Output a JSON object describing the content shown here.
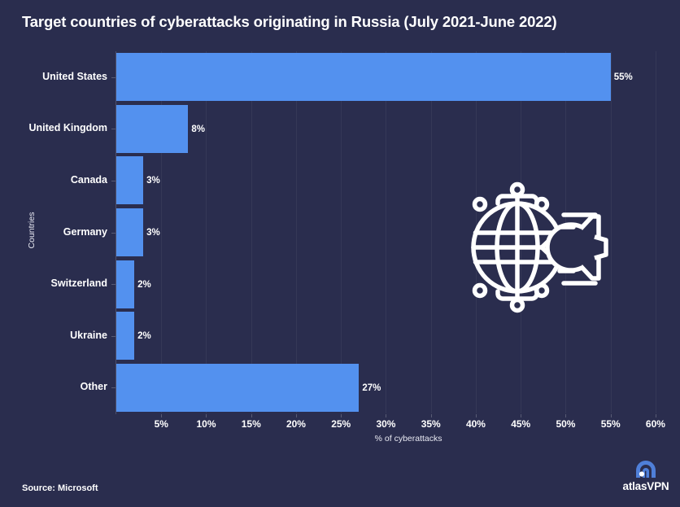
{
  "title": "Target countries of cyberattacks originating in Russia (July 2021-June 2022)",
  "source": "Source: Microsoft",
  "brand": {
    "name": "atlasVPN",
    "mark_icon": "atlasvpn-arc-logo-icon",
    "color": "#4f7fd9"
  },
  "illustration": {
    "icon": "globe-network-missile-icon",
    "color": "#ffffff"
  },
  "colors": {
    "background": "#2a2d4e",
    "bar": "#5391ef",
    "text": "#ffffff",
    "gridline": "rgba(255,255,255,0.055)"
  },
  "chart_data": {
    "type": "bar",
    "orientation": "horizontal",
    "title": "Target countries of cyberattacks originating in Russia (July 2021-June 2022)",
    "xlabel": "% of cyberattacks",
    "ylabel": "Countries",
    "categories": [
      "United States",
      "United Kingdom",
      "Canada",
      "Germany",
      "Switzerland",
      "Ukraine",
      "Other"
    ],
    "values": [
      55,
      8,
      3,
      3,
      2,
      2,
      27
    ],
    "value_labels": [
      "55%",
      "8%",
      "3%",
      "3%",
      "2%",
      "2%",
      "27%"
    ],
    "xlim": [
      0,
      61
    ],
    "xticks": [
      5,
      10,
      15,
      20,
      25,
      30,
      35,
      40,
      45,
      50,
      55,
      60
    ],
    "xtick_labels": [
      "5%",
      "10%",
      "15%",
      "20%",
      "25%",
      "30%",
      "35%",
      "40%",
      "45%",
      "50%",
      "55%",
      "60%"
    ],
    "grid": true,
    "legend": false,
    "series_color": "#5391ef"
  }
}
